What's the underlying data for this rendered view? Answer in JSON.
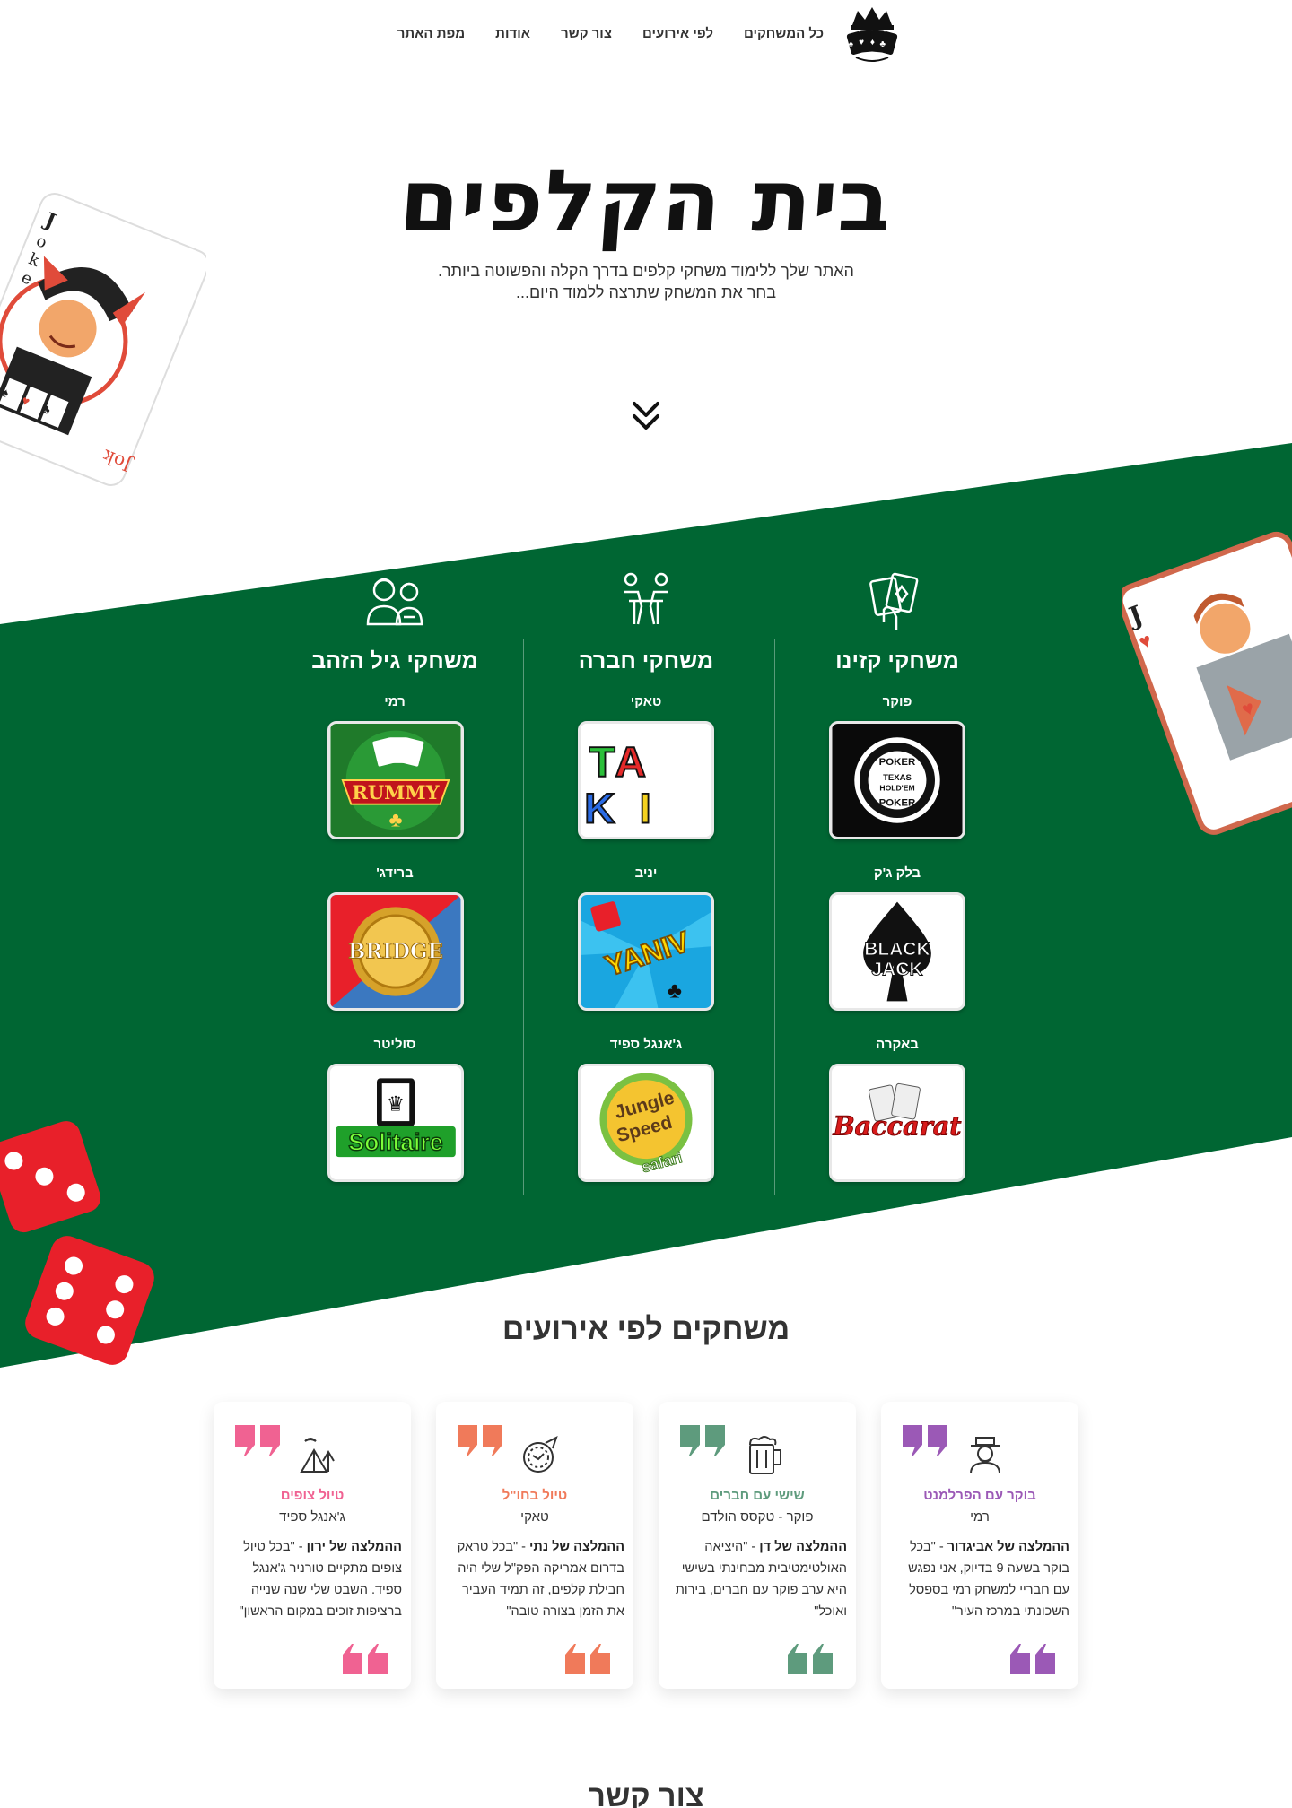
{
  "nav": {
    "logo_alt": "בית הקלפים",
    "links": [
      "כל המשחקים",
      "לפי אירועים",
      "צור קשר",
      "אודות",
      "מפת האתר"
    ]
  },
  "hero": {
    "title": "בית הקלפים",
    "subtitle_line1": "האתר שלך ללימוד משחקי קלפים בדרך הקלה והפשוטה ביותר.",
    "subtitle_line2": "בחר את המשחק שתרצה ללמוד היום..."
  },
  "categories": [
    {
      "title": "משחקי קזינו",
      "icon": "cards-hand-icon",
      "games": [
        {
          "label": "פוקר",
          "art": "POKER"
        },
        {
          "label": "בלק ג'ק",
          "art": "BLACK JACK"
        },
        {
          "label": "באקרה",
          "art": "Baccarat"
        }
      ]
    },
    {
      "title": "משחקי חברה",
      "icon": "friends-table-icon",
      "games": [
        {
          "label": "טאקי",
          "art": "TAKI"
        },
        {
          "label": "יניב",
          "art": "YANIV"
        },
        {
          "label": "ג'אנגל ספיד",
          "art": "Jungle Speed safari"
        }
      ]
    },
    {
      "title": "משחקי גיל הזהב",
      "icon": "elderly-couple-icon",
      "games": [
        {
          "label": "רמי",
          "art": "RUMMY"
        },
        {
          "label": "ברידג'",
          "art": "BRIDGE"
        },
        {
          "label": "סוליטר",
          "art": "Solitaire"
        }
      ]
    }
  ],
  "events": {
    "title": "משחקים לפי אירועים",
    "cards": [
      {
        "title": "בוקר עם הפרלמנט",
        "game": "רמי",
        "recommender": "ההמלצה של אביגדור",
        "quote": "- \"בכל בוקר בשעה 9 בדיוק, אני נפגש עם חבריי למשחק רמי בספסל השכונתי במרכז העיר\"",
        "color": "#9b59b6",
        "icon": "old-man-hat-icon"
      },
      {
        "title": "שישי עם חברים",
        "game": "פוקר - טקסס הולדם",
        "recommender": "ההמלצה של דן",
        "quote": "- \"היציאה האולטימטיבית מבחינתי בשישי היא ערב פוקר עם חברים, בירות ואוכל\"",
        "color": "#5e9b7d",
        "icon": "beer-mug-icon"
      },
      {
        "title": "טיול בחו\"ל",
        "game": "טאקי",
        "recommender": "ההמלצה של נתי",
        "quote": "- \"בכל טראק בדרום אמריקה הפק\"ל שלי היה חבילת קלפים, זה תמיד העביר את הזמן בצורה טובה\"",
        "color": "#f07a5a",
        "icon": "globe-plane-icon"
      },
      {
        "title": "טיול צופים",
        "game": "ג'אנגל ספיד",
        "recommender": "ההמלצה של ירון",
        "quote": "- \"בכל טיול צופים מתקיים טורניר ג'אנגל ספיד. השבט שלי שנה שנייה ברציפות זוכים במקום הראשון\"",
        "color": "#f06292",
        "icon": "camping-tent-icon"
      }
    ]
  },
  "contact": {
    "title": "צור קשר"
  },
  "colors": {
    "green": "#006633",
    "text": "#222222"
  }
}
